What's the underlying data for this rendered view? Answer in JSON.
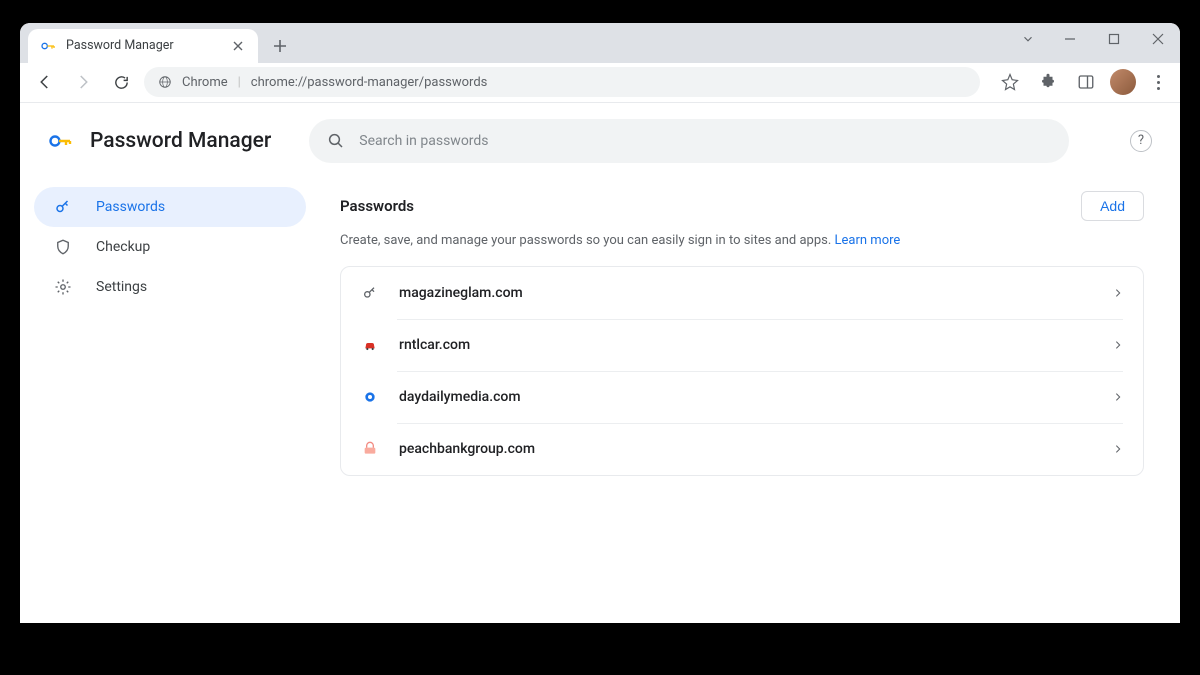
{
  "browser": {
    "tab_title": "Password Manager",
    "omnibox_label": "Chrome",
    "omnibox_url": "chrome://password-manager/passwords"
  },
  "app": {
    "title": "Password Manager",
    "search_placeholder": "Search in passwords"
  },
  "sidebar": {
    "items": [
      {
        "label": "Passwords"
      },
      {
        "label": "Checkup"
      },
      {
        "label": "Settings"
      }
    ]
  },
  "section": {
    "title": "Passwords",
    "add_label": "Add",
    "description": "Create, save, and manage your passwords so you can easily sign in to sites and apps.",
    "learn_more": "Learn more"
  },
  "passwords": [
    {
      "site": "magazineglam.com",
      "favicon_color": "#5f6368"
    },
    {
      "site": "rntlcar.com",
      "favicon_color": "#d93025"
    },
    {
      "site": "daydailymedia.com",
      "favicon_color": "#1a73e8"
    },
    {
      "site": "peachbankgroup.com",
      "favicon_color": "#f28b82"
    }
  ]
}
